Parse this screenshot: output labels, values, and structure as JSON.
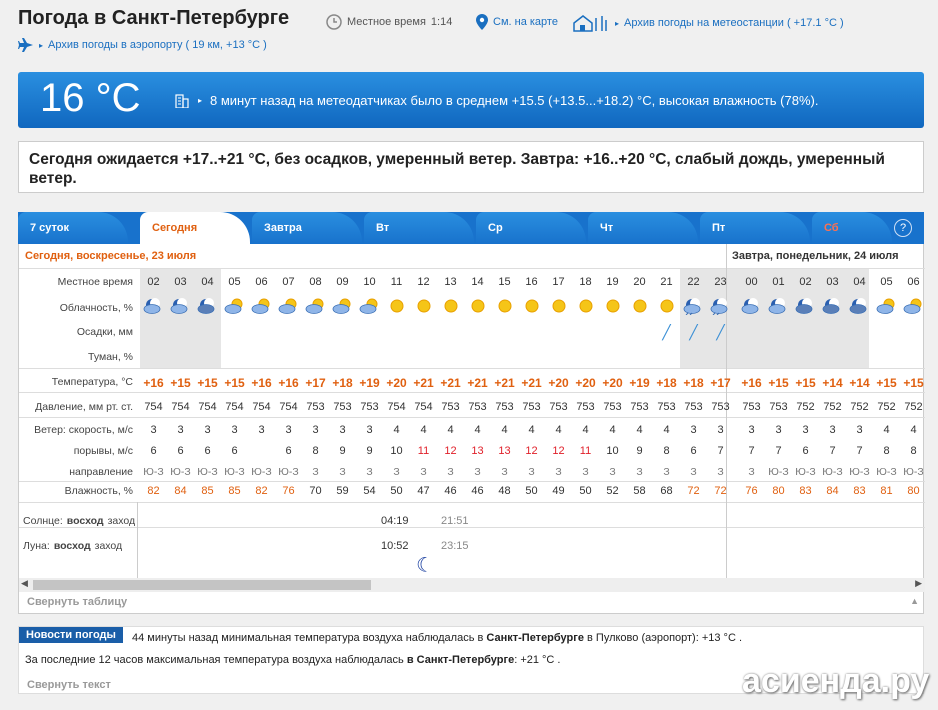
{
  "header": {
    "title": "Погода в Санкт-Петербурге",
    "local_time_label": "Местное время",
    "local_time": "1:14",
    "map_link": "См. на карте",
    "archive_station_link": "Архив погоды на метеостанции ( +17.1 °C )",
    "archive_airport_link": "Архив погоды в аэропорту ( 19 км, +13 °C )"
  },
  "current": {
    "temp": "16 °C",
    "text": "8 минут назад на метеодатчиках было в среднем +15.5 (+13.5...+18.2) °C, высокая влажность (78%)."
  },
  "forecast_text": "Сегодня ожидается +17..+21 °C, без осадков, умеренный ветер. Завтра: +16..+20 °C, слабый дождь, умеренный ветер.",
  "tabs": [
    {
      "label": "7 суток"
    },
    {
      "label": "Сегодня"
    },
    {
      "label": "Завтра"
    },
    {
      "label": "Вт"
    },
    {
      "label": "Ср"
    },
    {
      "label": "Чт"
    },
    {
      "label": "Пт"
    },
    {
      "label": "Сб"
    }
  ],
  "help_label": "?",
  "day_headers": {
    "today": "Сегодня, воскресенье, 23 июля",
    "tomorrow": "Завтра, понедельник, 24 июля"
  },
  "row_labels": {
    "time": "Местное время",
    "clouds": "Облачность, %",
    "precip": "Осадки, мм",
    "fog": "Туман, %",
    "temp": "Температура, °C",
    "pressure": "Давление, мм рт. ст.",
    "wind_speed": "Ветер: скорость, м/с",
    "gusts": "порывы, м/с",
    "direction": "направление",
    "humidity": "Влажность, %",
    "sun_prefix": "Солнце:",
    "sun_rise": "восход",
    "sun_set": "заход",
    "moon_prefix": "Луна:",
    "moon_rise": "восход",
    "moon_set": "заход",
    "moon_phase": "фаза"
  },
  "hours": [
    "02",
    "03",
    "04",
    "05",
    "06",
    "07",
    "08",
    "09",
    "10",
    "11",
    "12",
    "13",
    "14",
    "15",
    "16",
    "17",
    "18",
    "19",
    "20",
    "21",
    "22",
    "23",
    "00",
    "01",
    "02",
    "03",
    "04",
    "05",
    "06"
  ],
  "temps": [
    "+16",
    "+15",
    "+15",
    "+15",
    "+16",
    "+16",
    "+17",
    "+18",
    "+19",
    "+20",
    "+21",
    "+21",
    "+21",
    "+21",
    "+21",
    "+20",
    "+20",
    "+20",
    "+19",
    "+18",
    "+18",
    "+17",
    "+16",
    "+15",
    "+15",
    "+14",
    "+14",
    "+15",
    "+15"
  ],
  "pressure": [
    "754",
    "754",
    "754",
    "754",
    "754",
    "754",
    "753",
    "753",
    "753",
    "754",
    "754",
    "753",
    "753",
    "753",
    "753",
    "753",
    "753",
    "753",
    "753",
    "753",
    "753",
    "753",
    "753",
    "753",
    "752",
    "752",
    "752",
    "752",
    "752"
  ],
  "wind": [
    "3",
    "3",
    "3",
    "3",
    "3",
    "3",
    "3",
    "3",
    "3",
    "4",
    "4",
    "4",
    "4",
    "4",
    "4",
    "4",
    "4",
    "4",
    "4",
    "4",
    "3",
    "3",
    "3",
    "3",
    "3",
    "3",
    "3",
    "4",
    "4"
  ],
  "gusts": [
    "6",
    "6",
    "6",
    "6",
    "",
    "6",
    "8",
    "9",
    "9",
    "10",
    "11",
    "12",
    "13",
    "13",
    "12",
    "12",
    "11",
    "10",
    "9",
    "8",
    "6",
    "7",
    "7",
    "7",
    "6",
    "7",
    "7",
    "8",
    "8"
  ],
  "direction": [
    "Ю-З",
    "Ю-З",
    "Ю-З",
    "Ю-З",
    "Ю-З",
    "Ю-З",
    "З",
    "З",
    "З",
    "З",
    "З",
    "З",
    "З",
    "З",
    "З",
    "З",
    "З",
    "З",
    "З",
    "З",
    "З",
    "З",
    "З",
    "Ю-З",
    "Ю-З",
    "Ю-З",
    "Ю-З",
    "Ю-З",
    "Ю-З"
  ],
  "humidity": [
    "82",
    "84",
    "85",
    "85",
    "82",
    "76",
    "70",
    "59",
    "54",
    "50",
    "47",
    "46",
    "46",
    "48",
    "50",
    "49",
    "50",
    "52",
    "58",
    "68",
    "72",
    "72",
    "76",
    "80",
    "83",
    "84",
    "83",
    "81",
    "80"
  ],
  "sun": {
    "rise": "04:19",
    "set": "21:51"
  },
  "moon": {
    "rise": "10:52",
    "set": "23:15",
    "phase": "☽"
  },
  "collapse_table": "Свернуть таблицу",
  "news": {
    "badge": "Новости погоды",
    "line1_a": "44 минуты назад минимальная температура воздуха наблюдалась в ",
    "line1_b": "Санкт-Петербурге",
    "line1_c": " в Пулково (аэропорт): +13 °C .",
    "line2_a": "За последние 12 часов максимальная температура воздуха наблюдалась ",
    "line2_b": "в Санкт-Петербурге",
    "line2_c": ": +21 °C .",
    "collapse": "Свернуть текст"
  },
  "watermark": "асиенда.ру",
  "colors": {
    "accent": "#1872cc",
    "orange": "#e06010",
    "red": "#e0202a"
  }
}
